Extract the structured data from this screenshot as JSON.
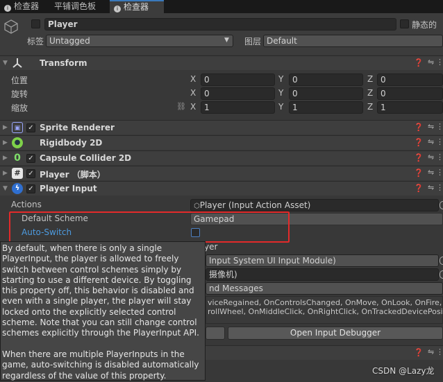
{
  "tabs": [
    {
      "label": "检查器",
      "active": false
    },
    {
      "label": "平铺调色板",
      "active": false
    },
    {
      "label": "检查器",
      "active": true
    }
  ],
  "object": {
    "name": "Player",
    "static_label": "静态的",
    "tag_label": "标签",
    "tag_value": "Untagged",
    "layer_label": "图层",
    "layer_value": "Default"
  },
  "transform": {
    "title": "Transform",
    "position_label": "位置",
    "rotation_label": "旋转",
    "scale_label": "缩放",
    "position": {
      "x": "0",
      "y": "0",
      "z": "0"
    },
    "rotation": {
      "x": "0",
      "y": "0",
      "z": "0"
    },
    "scale": {
      "x": "1",
      "y": "1",
      "z": "1"
    }
  },
  "axes": {
    "x": "X",
    "y": "Y",
    "z": "Z"
  },
  "components": [
    "Sprite Renderer",
    "Rigidbody 2D",
    "Capsule Collider 2D",
    "Player （脚本）",
    "Player Input"
  ],
  "player_input": {
    "actions_label": "Actions",
    "actions_value": "Player (Input Action Asset)",
    "default_scheme_label": "Default Scheme",
    "default_scheme_value": "Gamepad",
    "auto_switch_label": "Auto-Switch",
    "default_map_partial": "yer",
    "ui_module_partial": "Input System UI Input Module)",
    "camera_partial": "摄像机)",
    "behavior_partial": "nd Messages",
    "messages_line1": "viceRegained, OnControlsChanged, OnMove, OnLook, OnFire,",
    "messages_line2": "rollWheel, OnMiddleClick, OnRightClick, OnTrackedDevicePosition,",
    "debugger_button": "Open Input Debugger"
  },
  "tooltip": {
    "text": "By default, when there is only a single PlayerInput, the player is allowed to freely switch between control schemes simply by starting to use a different device. By toggling this property off, this behavior is disabled and even with a single player, the player will stay locked onto the explicitly selected control scheme. Note that you can still change control schemes explicitly through the PlayerInput API.\n\nWhen there are multiple PlayerInputs in the game, auto-switching is disabled automatically regardless of the value of this property."
  },
  "watermark": "CSDN @Lazy龙",
  "colors": {
    "link_blue": "#4d9be0",
    "highlight_red": "#e42a2a",
    "tab_accent": "#3a79bb"
  }
}
